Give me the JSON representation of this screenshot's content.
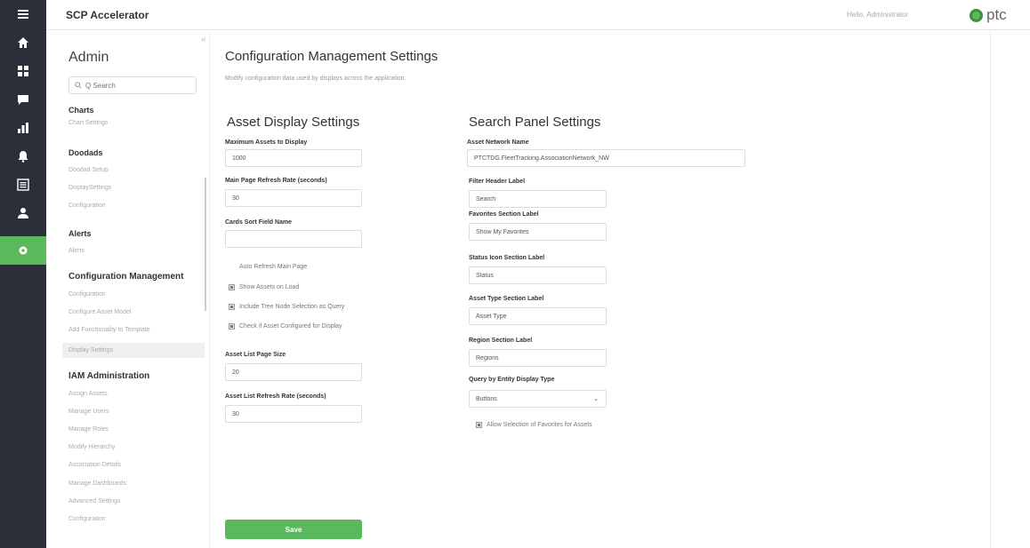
{
  "rail": {
    "icons": [
      "menu-icon",
      "home-icon",
      "dashboard-icon",
      "message-icon",
      "chart-icon",
      "bell-icon",
      "list-icon",
      "user-icon",
      "settings-icon"
    ],
    "accent": "#5cb85c"
  },
  "header": {
    "app_title": "SCP Accelerator",
    "greeting": "Hello, Administrator",
    "brand": "ptc"
  },
  "sidebar": {
    "title": "Admin",
    "search_placeholder": "Q Search",
    "sections": [
      {
        "title": "Charts",
        "items": [
          "Chart Settings"
        ]
      },
      {
        "title": "Doodads",
        "items": [
          "Doodad Setup",
          "DisplaySettings",
          "Configuration"
        ]
      },
      {
        "title": "Alerts",
        "items": [
          "Alerts"
        ]
      },
      {
        "title": "Configuration Management",
        "items": [
          "Configuration",
          "Configure Asset Model",
          "Add Functionality to Template",
          "Display Settings"
        ]
      },
      {
        "title": "IAM Administration",
        "items": [
          "Assign Assets",
          "Manage Users",
          "Manage Roles",
          "Modify Hierarchy",
          "Association Details",
          "Manage Dashboards",
          "Advanced Settings",
          "Configuration"
        ]
      }
    ]
  },
  "main": {
    "title": "Configuration Management Settings",
    "description": "Modify configuration data used by displays across the application.",
    "asset_display": {
      "title": "Asset Display Settings",
      "max_assets_label": "Maximum Assets to Display",
      "max_assets_value": "1000",
      "refresh_rate_label": "Main Page Refresh Rate (seconds)",
      "refresh_rate_value": "30",
      "cards_sort_label": "Cards Sort Field Name",
      "cards_sort_value": "",
      "checkboxes": [
        {
          "label": "Auto Refresh Main Page",
          "checked": false
        },
        {
          "label": "Show Assets on Load",
          "checked": true
        },
        {
          "label": "Include Tree Node Selection as Query",
          "checked": true
        },
        {
          "label": "Check if Asset Configured for Display",
          "checked": true
        }
      ],
      "list_page_size_label": "Asset List Page Size",
      "list_page_size_value": "20",
      "list_refresh_label": "Asset List Refresh Rate (seconds)",
      "list_refresh_value": "30"
    },
    "search_panel": {
      "title": "Search Panel Settings",
      "network_label": "Asset Network Name",
      "network_value": "PTCTDG.FleetTracking.AssociationNetwork_NW",
      "filter_header_label": "Filter Header Label",
      "filter_header_value": "Search",
      "favorites_label": "Favorites Section Label",
      "favorites_value": "Show My Favorites",
      "status_label": "Status Icon Section Label",
      "status_value": "Status",
      "asset_type_label": "Asset Type Section Label",
      "asset_type_value": "Asset Type",
      "region_label": "Region Section Label",
      "region_value": "Regions",
      "query_type_label": "Query by Entity Display Type",
      "query_type_value": "Buttons",
      "allow_favorites_label": "Allow Selection of Favorites for Assets",
      "allow_favorites_checked": true
    },
    "save_label": "Save"
  }
}
